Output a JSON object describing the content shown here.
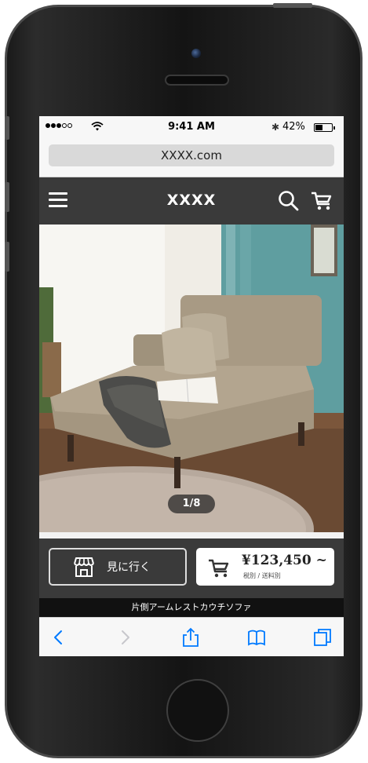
{
  "status_bar": {
    "time": "9:41 AM",
    "battery": "42%",
    "bluetooth_glyph": "✱"
  },
  "browser": {
    "url": "XXXX.com"
  },
  "site_header": {
    "logo": "XXXX"
  },
  "product": {
    "image_counter": "1/8",
    "name": "片側アームレストカウチソファ",
    "visit_label": "見に行く",
    "price": "¥123,450 ~",
    "price_note": "税別 / 送料別"
  },
  "colors": {
    "header_bg": "#3a3a3a",
    "accent_blue": "#007aff"
  },
  "icons": [
    "menu-icon",
    "search-icon",
    "cart-icon",
    "store-icon",
    "back-icon",
    "forward-icon",
    "share-icon",
    "bookmarks-icon",
    "tabs-icon"
  ]
}
